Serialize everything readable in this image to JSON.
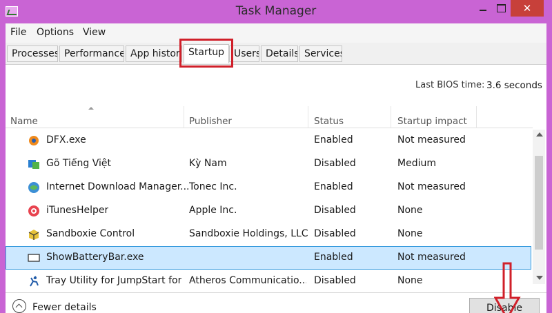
{
  "window": {
    "title": "Task Manager",
    "close_symbol": "✕"
  },
  "menu": [
    "File",
    "Options",
    "View"
  ],
  "tabs": [
    "Processes",
    "Performance",
    "App history",
    "Startup",
    "Users",
    "Details",
    "Services"
  ],
  "active_tab": "Startup",
  "bios": {
    "label": "Last BIOS time:",
    "value": "3.6 seconds"
  },
  "columns": {
    "name": "Name",
    "publisher": "Publisher",
    "status": "Status",
    "impact": "Startup impact"
  },
  "rows": [
    {
      "name": "DFX.exe",
      "publisher": "",
      "status": "Enabled",
      "impact": "Not measured",
      "icon": "dfx-icon"
    },
    {
      "name": "Gõ Tiếng Việt",
      "publisher": "Kỳ Nam",
      "status": "Disabled",
      "impact": "Medium",
      "icon": "gotiengviet-icon"
    },
    {
      "name": "Internet Download Manager...",
      "publisher": "Tonec Inc.",
      "status": "Enabled",
      "impact": "Not measured",
      "icon": "idm-icon"
    },
    {
      "name": "iTunesHelper",
      "publisher": "Apple Inc.",
      "status": "Disabled",
      "impact": "None",
      "icon": "itunes-icon"
    },
    {
      "name": "Sandboxie Control",
      "publisher": "Sandboxie Holdings, LLC",
      "status": "Disabled",
      "impact": "None",
      "icon": "sandboxie-icon"
    },
    {
      "name": "ShowBatteryBar.exe",
      "publisher": "",
      "status": "Enabled",
      "impact": "Not measured",
      "icon": "batterybar-icon",
      "selected": true
    },
    {
      "name": "Tray Utility for JumpStart for...",
      "publisher": "Atheros Communicatio...",
      "status": "Disabled",
      "impact": "None",
      "icon": "atheros-icon"
    }
  ],
  "footer": {
    "fewer_details": "Fewer details",
    "disable_button": "Disable"
  },
  "colors": {
    "window_frame": "#c964d4",
    "close_button": "#c7403a",
    "selection": "#cce8ff",
    "annotation": "#d0202a"
  }
}
